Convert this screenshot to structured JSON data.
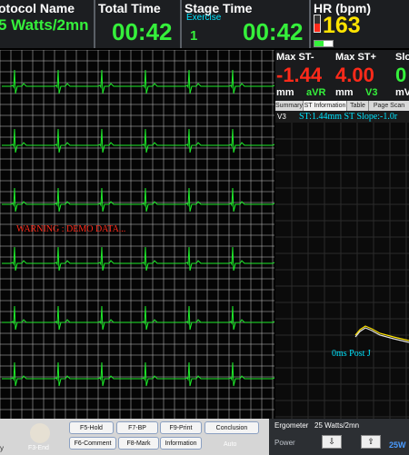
{
  "header": {
    "protocol_title": "otocol Name",
    "protocol_value": "5 Watts/2mn",
    "total_time_title": "Total Time",
    "total_time_value": "00:42",
    "stage_time_title": "Stage Time",
    "stage_label": "Exercise",
    "stage_number": "1",
    "stage_time_value": "00:42",
    "hr_title": "HR (bpm)",
    "hr_value": "163"
  },
  "ecg": {
    "warning_text": "WARNING : DEMO DATA...",
    "grid_color": "#c8c8c8",
    "trace_color": "#1eea2a"
  },
  "metrics": {
    "max_st_minus_title": "Max ST-",
    "max_st_minus_value": "-1.44",
    "max_st_minus_unit": "mm",
    "max_st_minus_lead": "aVR",
    "max_st_plus_title": "Max ST+",
    "max_st_plus_value": "4.00",
    "max_st_plus_unit": "mm",
    "max_st_plus_lead": "V3",
    "slope_title": "Slo",
    "slope_value": "0",
    "slope_unit": "mV"
  },
  "tabs": [
    {
      "label": "Summary"
    },
    {
      "label": "ST Information"
    },
    {
      "label": "Table"
    },
    {
      "label": "Page Scan"
    }
  ],
  "st_graph": {
    "lead_label": "V3",
    "info_text": "ST:1.44mm ST Slope:-1.0r",
    "post_j_label": "0ms Post J"
  },
  "buttons": [
    {
      "label": "F5-Hold"
    },
    {
      "label": "F7-BP"
    },
    {
      "label": "F9-Print"
    },
    {
      "label": "Conclusion"
    },
    {
      "label": "F6-Comment"
    },
    {
      "label": "F8-Mark"
    },
    {
      "label": "Information"
    },
    {
      "label": "Auto"
    }
  ],
  "left_bottom": {
    "status": "F3-End",
    "edge_char": "y"
  },
  "ergometer": {
    "label": "Ergometer",
    "value": "25 Watts/2mn",
    "power_label": "Power",
    "power_value": "25W"
  },
  "colors": {
    "green": "#35f03b",
    "red": "#ff2a1a",
    "cyan": "#00e5ff",
    "yellow": "#ffe400"
  }
}
